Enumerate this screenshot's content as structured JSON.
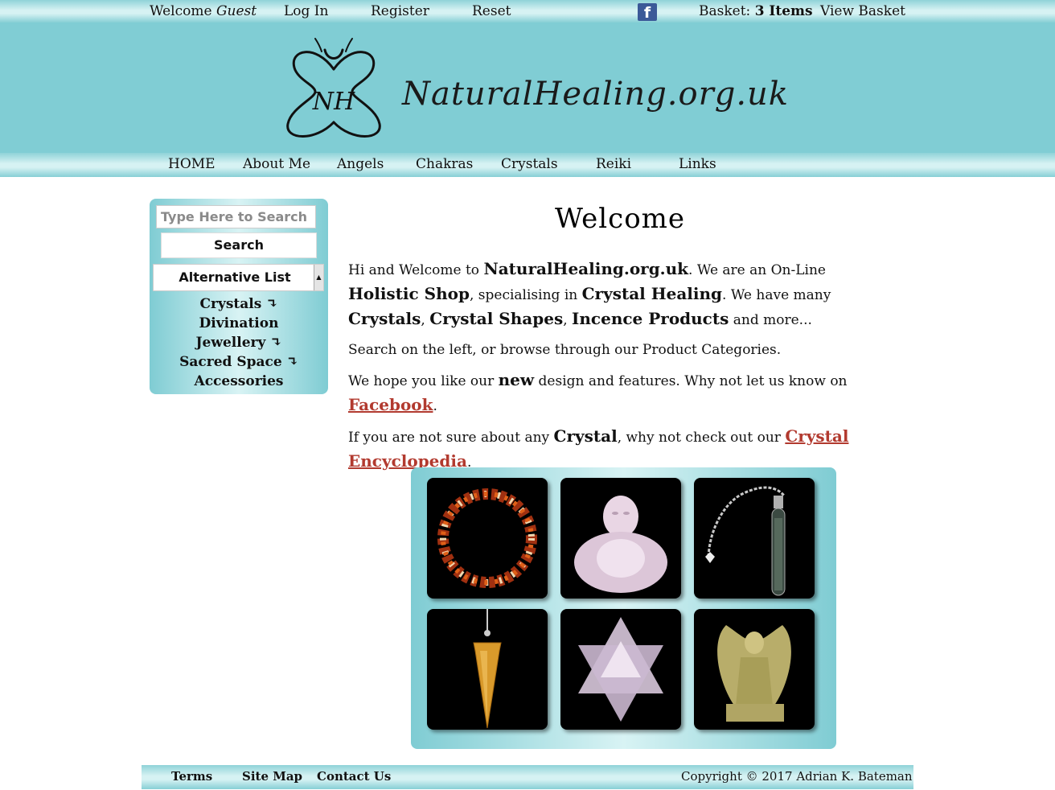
{
  "topbar": {
    "welcome_prefix": "Welcome ",
    "welcome_user": "Guest",
    "login": "Log In",
    "register": "Register",
    "reset": "Reset",
    "facebook_letter": "f",
    "basket_label": "Basket: ",
    "basket_count": "3 Items",
    "view_basket": "View Basket"
  },
  "header": {
    "logo_text": "NaturalHealing.org.uk",
    "logo_initials": "NH"
  },
  "nav": [
    "HOME",
    "About Me",
    "Angels",
    "Chakras",
    "Crystals",
    "Reiki",
    "Links"
  ],
  "sidebar": {
    "search_placeholder": "Type Here to Search",
    "search_button": "Search",
    "select_value": "Alternative List",
    "categories": [
      {
        "label": "Crystals",
        "arrow": "↴"
      },
      {
        "label": "Divination",
        "arrow": ""
      },
      {
        "label": "Jewellery",
        "arrow": "↴"
      },
      {
        "label": "Sacred Space",
        "arrow": "↴"
      },
      {
        "label": "Accessories",
        "arrow": ""
      }
    ]
  },
  "main": {
    "title": "Welcome",
    "p1": {
      "t1": "Hi and Welcome to ",
      "b1": "NaturalHealing.org.uk",
      "t2": ". We are an On-Line ",
      "b2": "Holistic Shop",
      "t3": ", specialising in ",
      "b3": "Crystal Healing",
      "t4": ". We have many ",
      "b4": "Crystals",
      "t5": ", ",
      "b5": "Crystal Shapes",
      "t6": ", ",
      "b6": "Incence Products",
      "t7": " and more..."
    },
    "p2": "Search on the left, or browse through our Product Categories.",
    "p3": {
      "t1": "We hope you like our ",
      "b1": "new",
      "t2": " design and features. Why not let us know on ",
      "link": "Facebook",
      "t3": "."
    },
    "p4": {
      "t1": "If you are not sure about any ",
      "b1": "Crystal",
      "t2": ", why not check out our ",
      "link": "Crystal Encyclopedia",
      "t3": "."
    }
  },
  "products": [
    {
      "icon": "chip-bracelet-image"
    },
    {
      "icon": "quartz-buddha-image"
    },
    {
      "icon": "pendulum-vial-image"
    },
    {
      "icon": "amber-pendulum-image"
    },
    {
      "icon": "merkaba-star-image"
    },
    {
      "icon": "angel-figurine-image"
    }
  ],
  "footer": {
    "terms": "Terms",
    "sitemap": "Site Map",
    "contact": "Contact Us",
    "copyright": "Copyright © 2017 Adrian K. Bateman"
  },
  "colors": {
    "header_bg": "#80cdd4",
    "bar_light": "#d6f2f3",
    "link": "#b23a2f",
    "facebook": "#3b5998"
  }
}
